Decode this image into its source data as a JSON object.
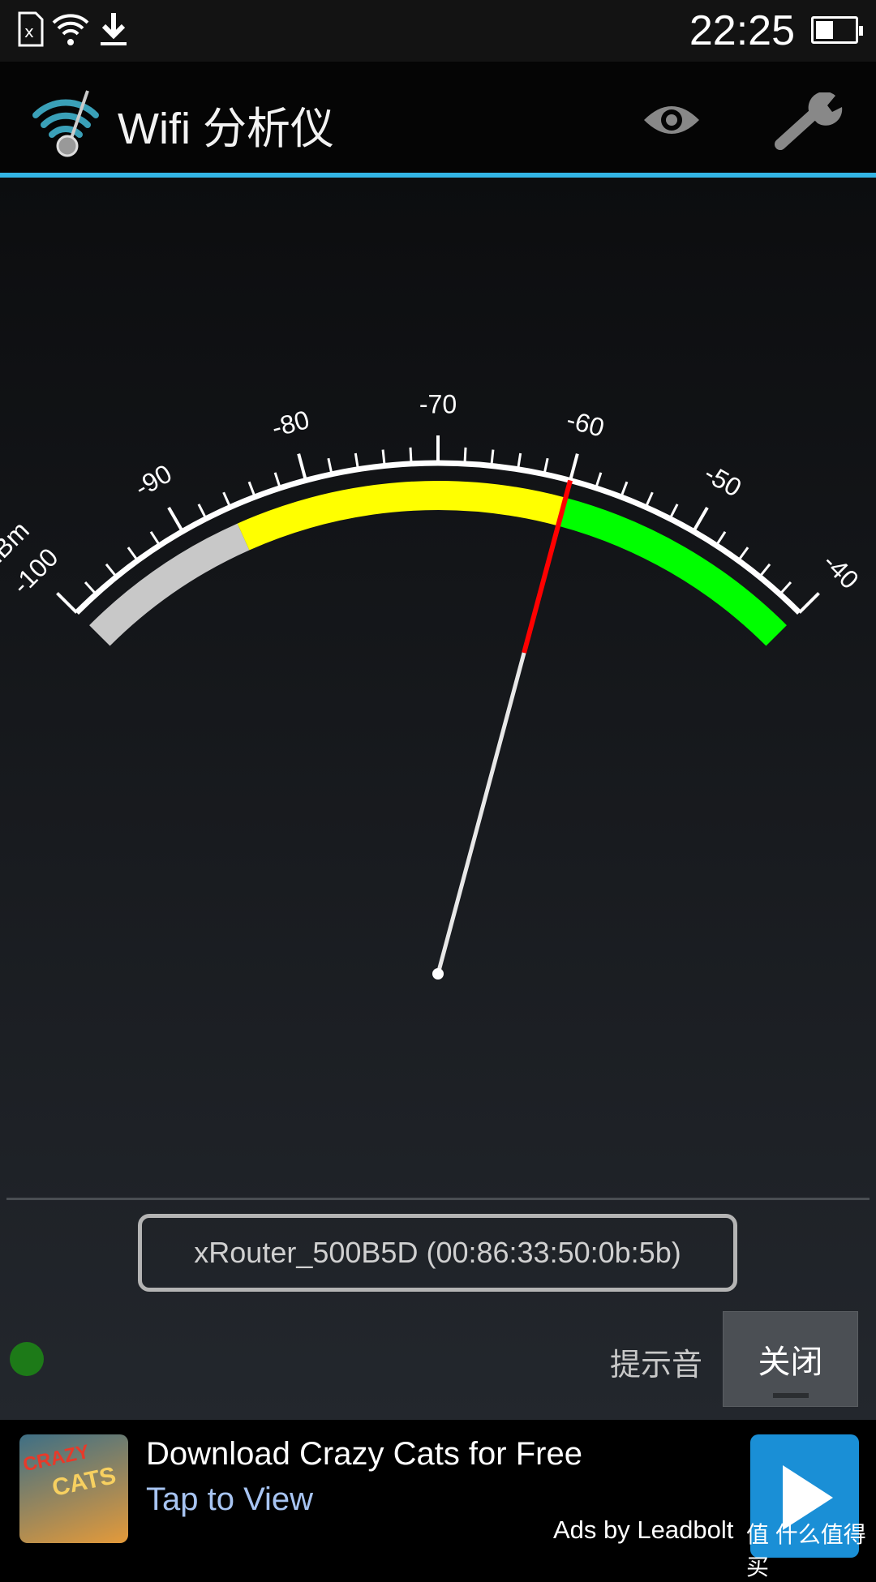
{
  "status_bar": {
    "time": "22:25",
    "battery_level": 0.45,
    "icons": [
      "sd-card-error-icon",
      "wifi-icon",
      "download-icon"
    ]
  },
  "app_bar": {
    "title": "Wifi 分析仪",
    "icons": [
      "wifi-meter-logo-icon",
      "eye-icon",
      "wrench-icon"
    ]
  },
  "colors": {
    "accent": "#33b5e5",
    "weak": "#c8c8c8",
    "medium": "#ffff00",
    "strong": "#00ff00",
    "needle_tip": "#ff0000"
  },
  "gauge": {
    "unit": "dBm",
    "min": -100,
    "max": -40,
    "major_labels": [
      "-100",
      "-90",
      "-80",
      "-70",
      "-60",
      "-50",
      "-40"
    ],
    "minor_step": 2,
    "bands": [
      {
        "from": -100,
        "to": -86,
        "color": "#c8c8c8"
      },
      {
        "from": -86,
        "to": -60,
        "color": "#ffff00"
      },
      {
        "from": -60,
        "to": -40,
        "color": "#00ff00"
      }
    ],
    "value": -60
  },
  "network": {
    "label": "xRouter_500B5D (00:86:33:50:0b:5b)"
  },
  "controls": {
    "beep_label": "提示音",
    "toggle_label": "关闭",
    "indicator_color": "#1d7a18"
  },
  "ad": {
    "title": "Download Crazy Cats for Free",
    "subtitle": "Tap to View",
    "by": "Ads by Leadbolt",
    "thumb_text_1": "CRAZY",
    "thumb_text_2": "CATS"
  },
  "watermark": "值 什么值得买"
}
